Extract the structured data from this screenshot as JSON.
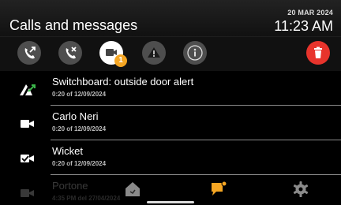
{
  "header": {
    "title": "Calls and messages",
    "date": "20 MAR 2024",
    "time": "11:23 AM"
  },
  "toolbar": {
    "buttons": [
      {
        "name": "answered-calls-filter",
        "icon": "phone-arrow-icon"
      },
      {
        "name": "missed-calls-filter",
        "icon": "phone-missed-icon"
      },
      {
        "name": "video-messages-filter",
        "icon": "video-camera-icon",
        "badge": "1",
        "selected": true
      },
      {
        "name": "alarms-filter",
        "icon": "warning-icon"
      },
      {
        "name": "info-filter",
        "icon": "info-icon"
      },
      {
        "name": "delete-button",
        "icon": "trash-icon"
      }
    ],
    "badge_color": "#f5a623",
    "delete_color": "#e8342c"
  },
  "list": [
    {
      "name": "Switchboard: outside door alert",
      "sub": "0:20 of 12/09/2024",
      "icon": "alarm-door-icon"
    },
    {
      "name": "Carlo Neri",
      "sub": "0:20 of 12/09/2024",
      "icon": "video-camera-icon"
    },
    {
      "name": "Wicket",
      "sub": "0:20 of 12/09/2024",
      "icon": "video-check-icon"
    },
    {
      "name": "Portone",
      "sub": "4:35 PM del 27/04/2024",
      "icon": "video-camera-icon"
    }
  ],
  "navbar": {
    "items": [
      {
        "name": "home",
        "icon": "home-icon",
        "active": false
      },
      {
        "name": "messages",
        "icon": "chat-icon",
        "active": true
      },
      {
        "name": "settings",
        "icon": "gear-icon",
        "active": false
      }
    ],
    "active_color": "#f5a623"
  }
}
